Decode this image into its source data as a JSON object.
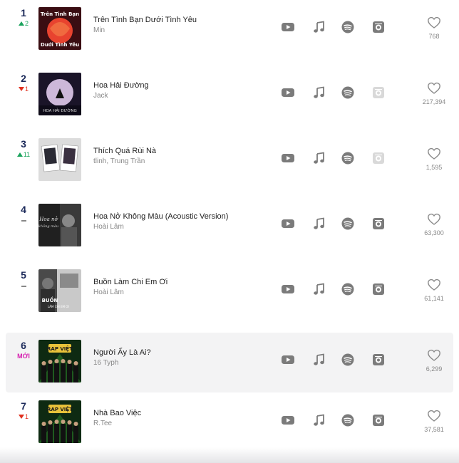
{
  "colors": {
    "rank": "#1c2a5a",
    "up": "#1aa35c",
    "down": "#e0301e",
    "new": "#d61fb0",
    "icon": "#7b7b7b",
    "icon_disabled": "#d9d9d9"
  },
  "rows": [
    {
      "rank": "1",
      "change": "2",
      "change_type": "up",
      "title": "Trên Tình Bạn Dưới Tình Yêu",
      "artist": "Min",
      "likes": "768",
      "zing": true,
      "cover_text": "Trên Tình Bạn Dưới Tình Yêu"
    },
    {
      "rank": "2",
      "change": "1",
      "change_type": "down",
      "title": "Hoa Hải Đường",
      "artist": "Jack",
      "likes": "217,394",
      "zing": false,
      "cover_text": "Hoa Hải Đường"
    },
    {
      "rank": "3",
      "change": "11",
      "change_type": "up",
      "title": "Thích Quá Rùi Nà",
      "artist": "tlinh, Trung Trần",
      "likes": "1,595",
      "zing": false,
      "cover_text": ""
    },
    {
      "rank": "4",
      "change": "",
      "change_type": "same",
      "title": "Hoa Nở Không Màu (Acoustic Version)",
      "artist": "Hoài Lâm",
      "likes": "63,300",
      "zing": true,
      "cover_text": "Hoa nở không màu"
    },
    {
      "rank": "5",
      "change": "",
      "change_type": "same",
      "title": "Buồn Làm Chi Em Ơi",
      "artist": "Hoài Lâm",
      "likes": "61,141",
      "zing": true,
      "cover_text": "BUỒN LÀM CHI EM ƠI"
    },
    {
      "rank": "6",
      "change": "MỚI",
      "change_type": "new",
      "title": "Người Ấy Là Ai?",
      "artist": "16 Typh",
      "likes": "6,299",
      "zing": true,
      "cover_text": "RAP VIỆT"
    },
    {
      "rank": "7",
      "change": "1",
      "change_type": "down",
      "title": "Nhà Bao Việc",
      "artist": "R.Tee",
      "likes": "37,581",
      "zing": true,
      "cover_text": "RAP VIỆT"
    }
  ]
}
